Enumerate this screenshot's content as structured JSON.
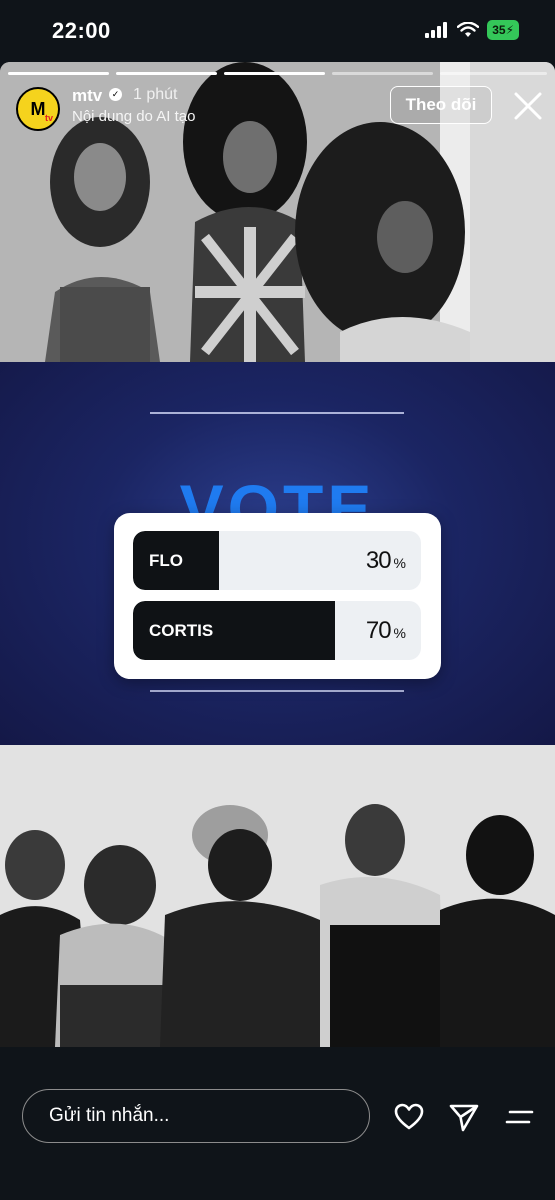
{
  "status_bar": {
    "time": "22:00",
    "battery": "35"
  },
  "story": {
    "account_name": "mtv",
    "avatar_text": "M",
    "avatar_sub": "tv",
    "time_ago": "1 phút",
    "ai_label": "Nội dung do AI tạo",
    "follow_label": "Theo dõi",
    "progress_segments": 5,
    "progress_current_index": 2,
    "progress_current_fill": 1.0,
    "background_title": "VOTE"
  },
  "poll": {
    "options": [
      {
        "label": "FLO",
        "percent": "30",
        "percent_symbol": "%",
        "fill": 0.3
      },
      {
        "label": "CORTIS",
        "percent": "70",
        "percent_symbol": "%",
        "fill": 0.7
      }
    ]
  },
  "bottom_bar": {
    "message_placeholder": "Gửi tin nhắn..."
  },
  "colors": {
    "accent_blue": "#1f7bf0",
    "poll_fill": "#0f1215",
    "poll_track": "#edf0f3",
    "battery": "#34c759"
  },
  "icons": [
    "signal-icon",
    "wifi-icon",
    "battery-icon",
    "verified-icon",
    "close-icon",
    "heart-icon",
    "send-icon",
    "menu-icon"
  ]
}
